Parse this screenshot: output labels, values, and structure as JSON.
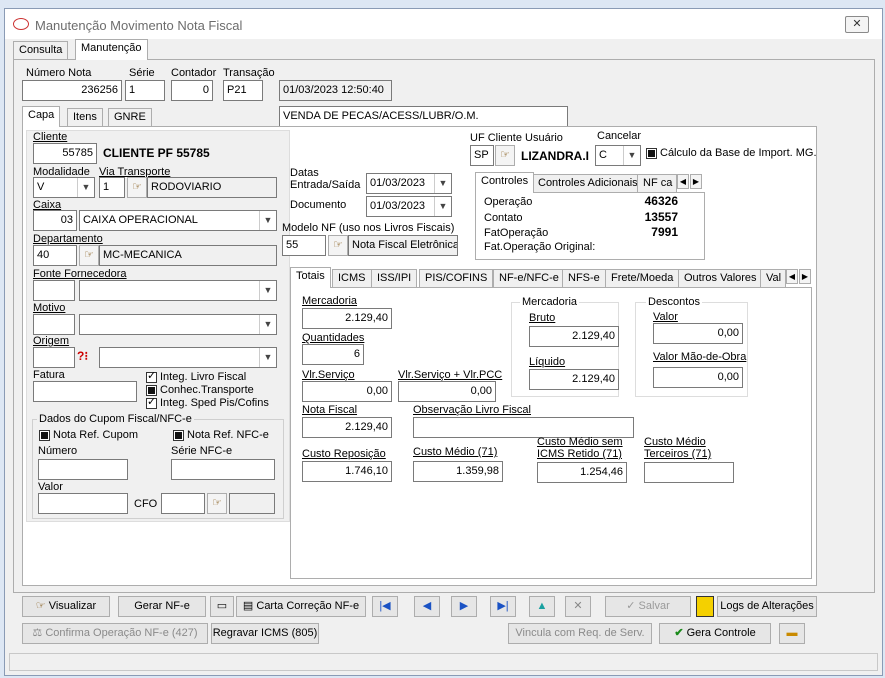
{
  "window": {
    "title": "Manutenção Movimento Nota Fiscal",
    "close": "✕"
  },
  "top_tabs": [
    "Consulta",
    "Manutenção"
  ],
  "header": {
    "numero_label": "Número Nota",
    "numero": "236256",
    "serie_label": "Série",
    "serie": "1",
    "contador_label": "Contador",
    "contador": "0",
    "transacao_label": "Transação",
    "transacao": "P21",
    "datetime": "01/03/2023 12:50:40",
    "desc": "VENDA DE PECAS/ACESS/LUBR/O.M."
  },
  "sub_tabs": [
    "Capa",
    "Itens",
    "GNRE"
  ],
  "left": {
    "cliente_label": "Cliente",
    "cliente_code": "55785",
    "cliente_name": "CLIENTE PF 55785",
    "modalidade_label": "Modalidade",
    "modalidade": "V",
    "via_label": "Via Transporte",
    "via_code": "1",
    "via_name": "RODOVIARIO",
    "caixa_label": "Caixa",
    "caixa_code": "03",
    "caixa_name": "CAIXA OPERACIONAL",
    "depto_label": "Departamento",
    "depto_code": "40",
    "depto_name": "MC-MECANICA",
    "fonte_label": "Fonte Fornecedora",
    "motivo_label": "Motivo",
    "origem_label": "Origem",
    "fatura_label": "Fatura",
    "chk_livro": "Integ. Livro Fiscal",
    "chk_conhec": "Conhec.Transporte",
    "chk_sped": "Integ. Sped Pis/Cofins",
    "cupom_title": "Dados do Cupom Fiscal/NFC-e",
    "nota_ref_cupom": "Nota Ref. Cupom",
    "nota_ref_nfce": "Nota Ref. NFC-e",
    "numero_label": "Número",
    "serie_nfce_label": "Série NFC-e",
    "valor_label": "Valor",
    "cfo_label": "CFO"
  },
  "datas": {
    "title": "Datas",
    "entrada_label": "Entrada/Saída",
    "entrada": "01/03/2023",
    "documento_label": "Documento",
    "documento": "01/03/2023"
  },
  "uf": {
    "label": "UF Cliente Usuário",
    "uf": "SP",
    "name": "LIZANDRA.I",
    "cancelar_label": "Cancelar",
    "cancelar": "C",
    "calc_label": "Cálculo da Base de Import. MG."
  },
  "modelo": {
    "label": "Modelo NF (uso nos Livros Fiscais)",
    "code": "55",
    "name": "Nota Fiscal Eletrônica"
  },
  "controles": {
    "tabs": [
      "Controles",
      "Controles Adicionais",
      "NF ca"
    ],
    "rows": [
      {
        "label": "Operação",
        "value": "46326"
      },
      {
        "label": "Contato",
        "value": "13557"
      },
      {
        "label": "FatOperação",
        "value": "7991"
      },
      {
        "label": "Fat.Operação Original:",
        "value": ""
      }
    ]
  },
  "totals_tabs": [
    "Totais",
    "ICMS",
    "ISS/IPI",
    "PIS/COFINS",
    "NF-e/NFC-e",
    "NFS-e",
    "Frete/Moeda",
    "Outros Valores",
    "Val"
  ],
  "totais": {
    "mercadoria_label": "Mercadoria",
    "mercadoria": "2.129,40",
    "quantidades_label": "Quantidades",
    "quantidades": "6",
    "vlr_servico_label": "Vlr.Serviço",
    "vlr_servico": "0,00",
    "vlr_servico_pcc_label": "Vlr.Serviço + Vlr.PCC",
    "vlr_servico_pcc": "0,00",
    "nota_fiscal_label": "Nota Fiscal",
    "nota_fiscal": "2.129,40",
    "obs_label": "Observação Livro Fiscal",
    "obs": "",
    "merc_group": "Mercadoria",
    "bruto_label": "Bruto",
    "bruto": "2.129,40",
    "liquido_label": "Líquido",
    "liquido": "2.129,40",
    "desc_group": "Descontos",
    "desc_valor_label": "Valor",
    "desc_valor": "0,00",
    "mao_obra_label": "Valor Mão-de-Obra",
    "mao_obra": "0,00",
    "custo_rep_label": "Custo Reposição",
    "custo_rep": "1.746,10",
    "custo_medio_label": "Custo Médio (71)",
    "custo_medio": "1.359,98",
    "custo_sem_label1": "Custo Médio sem",
    "custo_sem_label2": "ICMS Retido (71)",
    "custo_sem": "1.254,46",
    "custo_terc_label1": "Custo Médio",
    "custo_terc_label2": "Terceiros (71)",
    "custo_terc": ""
  },
  "buttons": {
    "visualizar": "Visualizar",
    "gerar_nfe": "Gerar NF-e",
    "carta": "Carta Correção NF-e",
    "salvar": "Salvar",
    "logs": "Logs de Alterações",
    "confirma": "Confirma Operação NF-e (427)",
    "regravar": "Regravar ICMS (805)",
    "vincula": "Vincula com Req. de Serv.",
    "gera_controle": "Gera Controle"
  }
}
